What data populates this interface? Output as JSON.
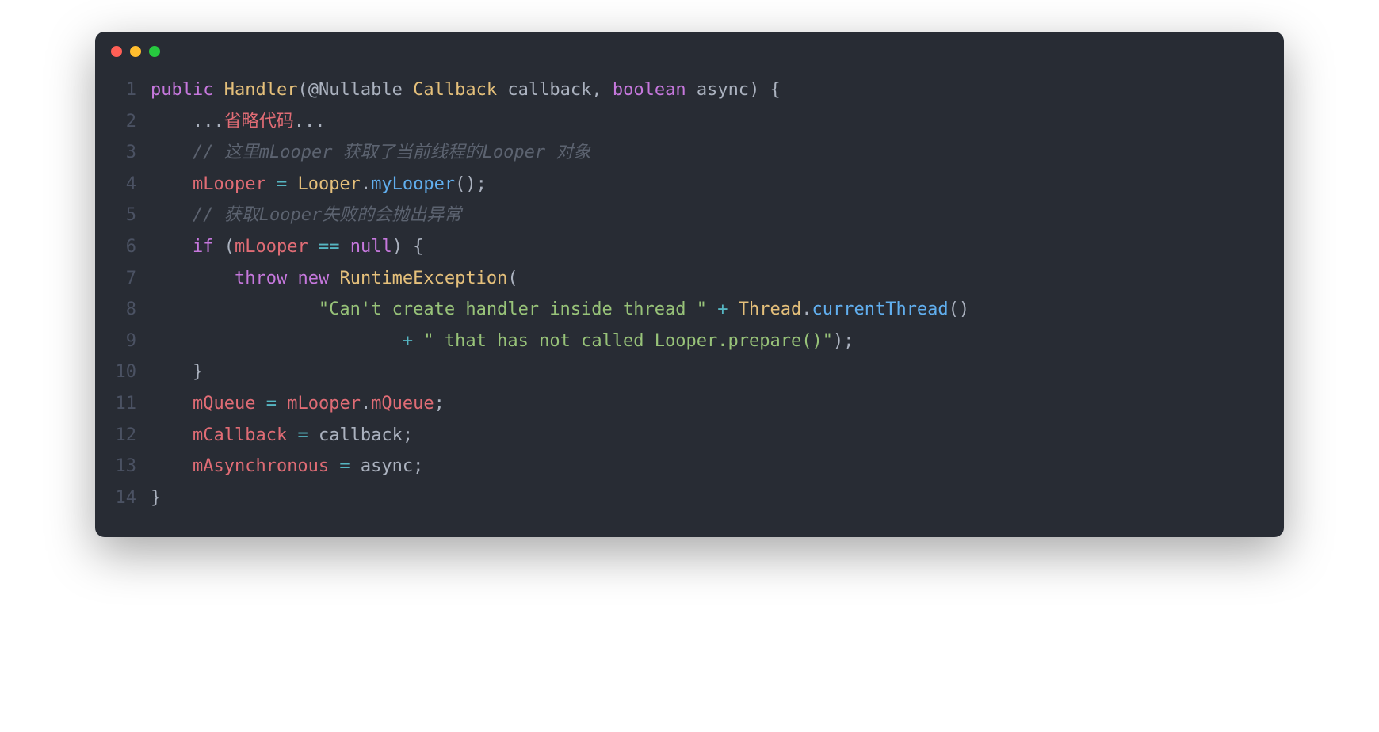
{
  "window": {
    "dots": [
      "red",
      "yellow",
      "green"
    ]
  },
  "code": {
    "lines": [
      {
        "n": "1",
        "tokens": [
          {
            "c": "keyword",
            "t": "public"
          },
          {
            "c": "default",
            "t": " "
          },
          {
            "c": "type",
            "t": "Handler"
          },
          {
            "c": "punct",
            "t": "("
          },
          {
            "c": "anno",
            "t": "@Nullable"
          },
          {
            "c": "default",
            "t": " "
          },
          {
            "c": "type",
            "t": "Callback"
          },
          {
            "c": "default",
            "t": " "
          },
          {
            "c": "param",
            "t": "callback"
          },
          {
            "c": "punct",
            "t": ", "
          },
          {
            "c": "keyword",
            "t": "boolean"
          },
          {
            "c": "default",
            "t": " "
          },
          {
            "c": "param",
            "t": "async"
          },
          {
            "c": "punct",
            "t": ") {"
          }
        ]
      },
      {
        "n": "2",
        "tokens": [
          {
            "c": "default",
            "t": "    ..."
          },
          {
            "c": "ident",
            "t": "省略代码"
          },
          {
            "c": "default",
            "t": "..."
          }
        ]
      },
      {
        "n": "3",
        "tokens": [
          {
            "c": "default",
            "t": "    "
          },
          {
            "c": "comment",
            "t": "// 这里mLooper 获取了当前线程的Looper 对象"
          }
        ]
      },
      {
        "n": "4",
        "tokens": [
          {
            "c": "default",
            "t": "    "
          },
          {
            "c": "ident",
            "t": "mLooper"
          },
          {
            "c": "default",
            "t": " "
          },
          {
            "c": "op",
            "t": "="
          },
          {
            "c": "default",
            "t": " "
          },
          {
            "c": "type",
            "t": "Looper"
          },
          {
            "c": "punct",
            "t": "."
          },
          {
            "c": "func",
            "t": "myLooper"
          },
          {
            "c": "punct",
            "t": "();"
          }
        ]
      },
      {
        "n": "5",
        "tokens": [
          {
            "c": "default",
            "t": "    "
          },
          {
            "c": "comment",
            "t": "// 获取Looper失败的会抛出异常"
          }
        ]
      },
      {
        "n": "6",
        "tokens": [
          {
            "c": "default",
            "t": "    "
          },
          {
            "c": "keyword",
            "t": "if"
          },
          {
            "c": "default",
            "t": " "
          },
          {
            "c": "punct",
            "t": "("
          },
          {
            "c": "ident",
            "t": "mLooper"
          },
          {
            "c": "default",
            "t": " "
          },
          {
            "c": "op",
            "t": "=="
          },
          {
            "c": "default",
            "t": " "
          },
          {
            "c": "keyword",
            "t": "null"
          },
          {
            "c": "punct",
            "t": ") {"
          }
        ]
      },
      {
        "n": "7",
        "tokens": [
          {
            "c": "default",
            "t": "        "
          },
          {
            "c": "keyword",
            "t": "throw"
          },
          {
            "c": "default",
            "t": " "
          },
          {
            "c": "keyword",
            "t": "new"
          },
          {
            "c": "default",
            "t": " "
          },
          {
            "c": "type",
            "t": "RuntimeException"
          },
          {
            "c": "punct",
            "t": "("
          }
        ]
      },
      {
        "n": "8",
        "tokens": [
          {
            "c": "default",
            "t": "                "
          },
          {
            "c": "string",
            "t": "\"Can't create handler inside thread \""
          },
          {
            "c": "default",
            "t": " "
          },
          {
            "c": "op",
            "t": "+"
          },
          {
            "c": "default",
            "t": " "
          },
          {
            "c": "type",
            "t": "Thread"
          },
          {
            "c": "punct",
            "t": "."
          },
          {
            "c": "func",
            "t": "currentThread"
          },
          {
            "c": "punct",
            "t": "()"
          }
        ]
      },
      {
        "n": "9",
        "tokens": [
          {
            "c": "default",
            "t": "                        "
          },
          {
            "c": "op",
            "t": "+"
          },
          {
            "c": "default",
            "t": " "
          },
          {
            "c": "string",
            "t": "\" that has not called Looper.prepare()\""
          },
          {
            "c": "punct",
            "t": ");"
          }
        ]
      },
      {
        "n": "10",
        "tokens": [
          {
            "c": "default",
            "t": "    "
          },
          {
            "c": "punct",
            "t": "}"
          }
        ]
      },
      {
        "n": "11",
        "tokens": [
          {
            "c": "default",
            "t": "    "
          },
          {
            "c": "ident",
            "t": "mQueue"
          },
          {
            "c": "default",
            "t": " "
          },
          {
            "c": "op",
            "t": "="
          },
          {
            "c": "default",
            "t": " "
          },
          {
            "c": "ident",
            "t": "mLooper"
          },
          {
            "c": "punct",
            "t": "."
          },
          {
            "c": "ident",
            "t": "mQueue"
          },
          {
            "c": "punct",
            "t": ";"
          }
        ]
      },
      {
        "n": "12",
        "tokens": [
          {
            "c": "default",
            "t": "    "
          },
          {
            "c": "ident",
            "t": "mCallback"
          },
          {
            "c": "default",
            "t": " "
          },
          {
            "c": "op",
            "t": "="
          },
          {
            "c": "default",
            "t": " "
          },
          {
            "c": "param",
            "t": "callback"
          },
          {
            "c": "punct",
            "t": ";"
          }
        ]
      },
      {
        "n": "13",
        "tokens": [
          {
            "c": "default",
            "t": "    "
          },
          {
            "c": "ident",
            "t": "mAsynchronous"
          },
          {
            "c": "default",
            "t": " "
          },
          {
            "c": "op",
            "t": "="
          },
          {
            "c": "default",
            "t": " "
          },
          {
            "c": "param",
            "t": "async"
          },
          {
            "c": "punct",
            "t": ";"
          }
        ]
      },
      {
        "n": "14",
        "tokens": [
          {
            "c": "punct",
            "t": "}"
          }
        ]
      }
    ]
  }
}
